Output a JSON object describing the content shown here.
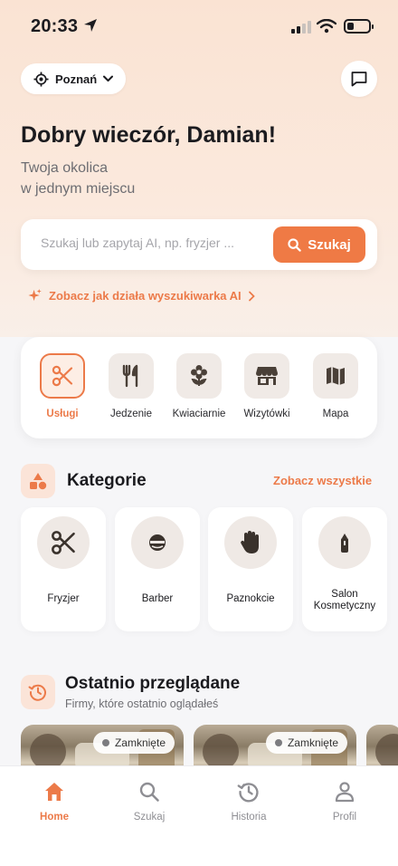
{
  "status_bar": {
    "time": "20:33"
  },
  "header": {
    "city": "Poznań",
    "greeting": "Dobry wieczór, Damian!",
    "subtitle_line1": "Twoja okolica",
    "subtitle_line2": "w jednym miejscu"
  },
  "search": {
    "placeholder": "Szukaj lub zapytaj AI, np. fryzjer ...",
    "button_label": "Szukaj",
    "ai_link": "Zobacz jak działa wyszukiwarka AI"
  },
  "quick_nav": [
    {
      "label": "Usługi",
      "icon": "scissors-icon",
      "active": true
    },
    {
      "label": "Jedzenie",
      "icon": "cutlery-icon",
      "active": false
    },
    {
      "label": "Kwiaciarnie",
      "icon": "flower-icon",
      "active": false
    },
    {
      "label": "Wizytówki",
      "icon": "storefront-icon",
      "active": false
    },
    {
      "label": "Mapa",
      "icon": "map-icon",
      "active": false
    }
  ],
  "categories": {
    "title": "Kategorie",
    "see_all": "Zobacz wszystkie",
    "items": [
      {
        "label": "Fryzjer",
        "icon": "scissors-icon"
      },
      {
        "label": "Barber",
        "icon": "barber-face-icon"
      },
      {
        "label": "Paznokcie",
        "icon": "hand-icon"
      },
      {
        "label": "Salon Kosmetyczny",
        "icon": "lipstick-icon"
      }
    ]
  },
  "recent": {
    "title": "Ostatnio przeglądane",
    "subtitle": "Firmy, które ostatnio oglądałeś",
    "places": [
      {
        "status": "Zamknięte"
      },
      {
        "status": "Zamknięte"
      }
    ]
  },
  "tab_bar": [
    {
      "label": "Home",
      "icon": "home-icon",
      "active": true
    },
    {
      "label": "Szukaj",
      "icon": "search-icon",
      "active": false
    },
    {
      "label": "Historia",
      "icon": "history-icon",
      "active": false
    },
    {
      "label": "Profil",
      "icon": "profile-icon",
      "active": false
    }
  ],
  "colors": {
    "accent": "#ec7a49",
    "hero_bg": "#fae3d3",
    "icon_tile": "#f0eae6",
    "text_primary": "#1b1b1f",
    "text_secondary": "#6d6d72"
  }
}
